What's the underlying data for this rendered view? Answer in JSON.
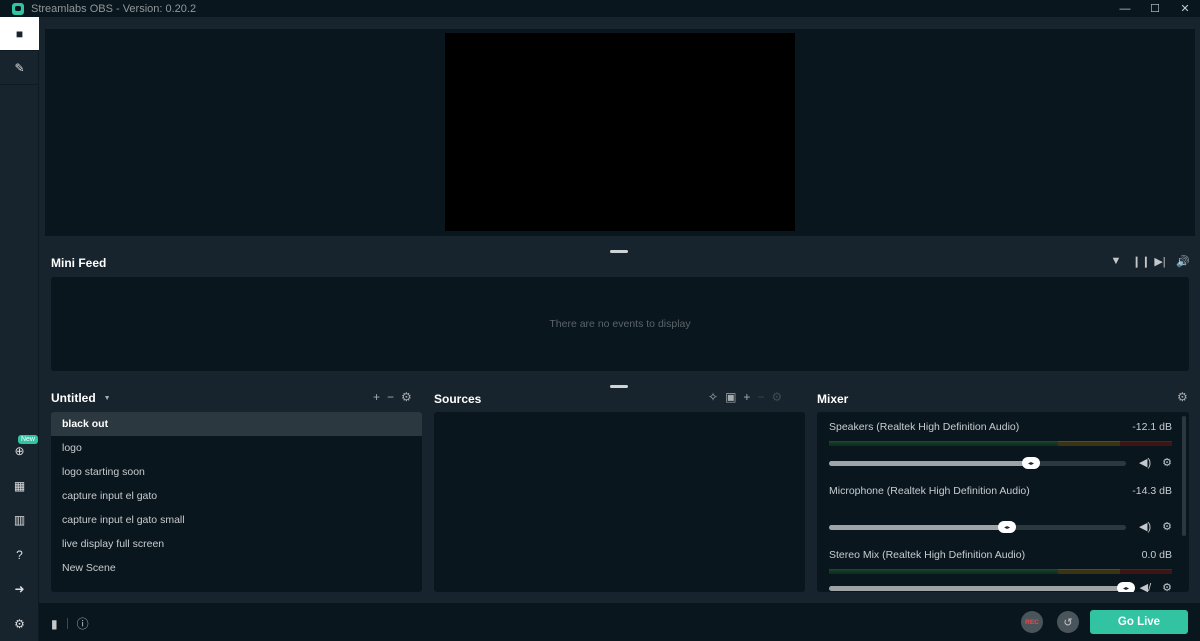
{
  "window": {
    "title": "Streamlabs OBS - Version: 0.20.2",
    "controls": {
      "minimize": "—",
      "maximize": "☐",
      "close": "✕"
    }
  },
  "sidebar": {
    "top": [
      {
        "name": "studio-mode",
        "icon": "video-camera-icon",
        "glyph": "■",
        "active": true
      },
      {
        "name": "themes",
        "icon": "themes-icon",
        "glyph": "✎",
        "active": false
      }
    ],
    "bottom": [
      {
        "name": "apps",
        "icon": "globe-icon",
        "glyph": "⊕",
        "badge": "New"
      },
      {
        "name": "layout",
        "icon": "layout-grid-icon",
        "glyph": "▦"
      },
      {
        "name": "library",
        "icon": "library-icon",
        "glyph": "▥"
      },
      {
        "name": "help",
        "icon": "help-icon",
        "glyph": "?"
      },
      {
        "name": "login",
        "icon": "login-icon",
        "glyph": "➜"
      },
      {
        "name": "settings",
        "icon": "gear-icon",
        "glyph": "⚙"
      }
    ]
  },
  "minifeed": {
    "title": "Mini Feed",
    "empty_text": "There are no events to display",
    "controls": [
      {
        "name": "filter",
        "glyph": "▼"
      },
      {
        "name": "pause",
        "glyph": "❙❙"
      },
      {
        "name": "skip",
        "glyph": "▶|"
      },
      {
        "name": "volume",
        "glyph": "🔊"
      }
    ]
  },
  "scenes": {
    "collection": "Untitled",
    "tools": {
      "add": "+",
      "remove": "−",
      "settings": "⚙"
    },
    "items": [
      {
        "label": "black out",
        "selected": true
      },
      {
        "label": "logo",
        "selected": false
      },
      {
        "label": "logo starting soon",
        "selected": false
      },
      {
        "label": "capture input el gato",
        "selected": false
      },
      {
        "label": "capture input el gato small",
        "selected": false
      },
      {
        "label": "live display full screen",
        "selected": false
      },
      {
        "label": "New Scene",
        "selected": false
      }
    ]
  },
  "sources": {
    "title": "Sources",
    "tools": {
      "audio": "✧",
      "folder": "▣",
      "add": "+",
      "remove": "−",
      "settings": "⚙"
    },
    "items": []
  },
  "mixer": {
    "title": "Mixer",
    "settings": "⚙",
    "items": [
      {
        "name": "Speakers (Realtek High Definition Audio)",
        "db": "-12.1 dB",
        "volume": 0.68,
        "meter": true,
        "muted": false
      },
      {
        "name": "Microphone (Realtek High Definition Audio)",
        "db": "-14.3 dB",
        "volume": 0.6,
        "meter": false,
        "muted": false
      },
      {
        "name": "Stereo Mix (Realtek High Definition Audio)",
        "db": "0.0 dB",
        "volume": 1.0,
        "meter": true,
        "muted": true
      }
    ]
  },
  "footer": {
    "stats_icon": "▮",
    "info_icon": "ⓘ",
    "rec_label": "REC",
    "replay_glyph": "↺",
    "go_live_label": "Go Live"
  },
  "colors": {
    "accent": "#31c3a2",
    "background": "#17242d",
    "panel": "#09161d",
    "rec": "#f04848"
  }
}
